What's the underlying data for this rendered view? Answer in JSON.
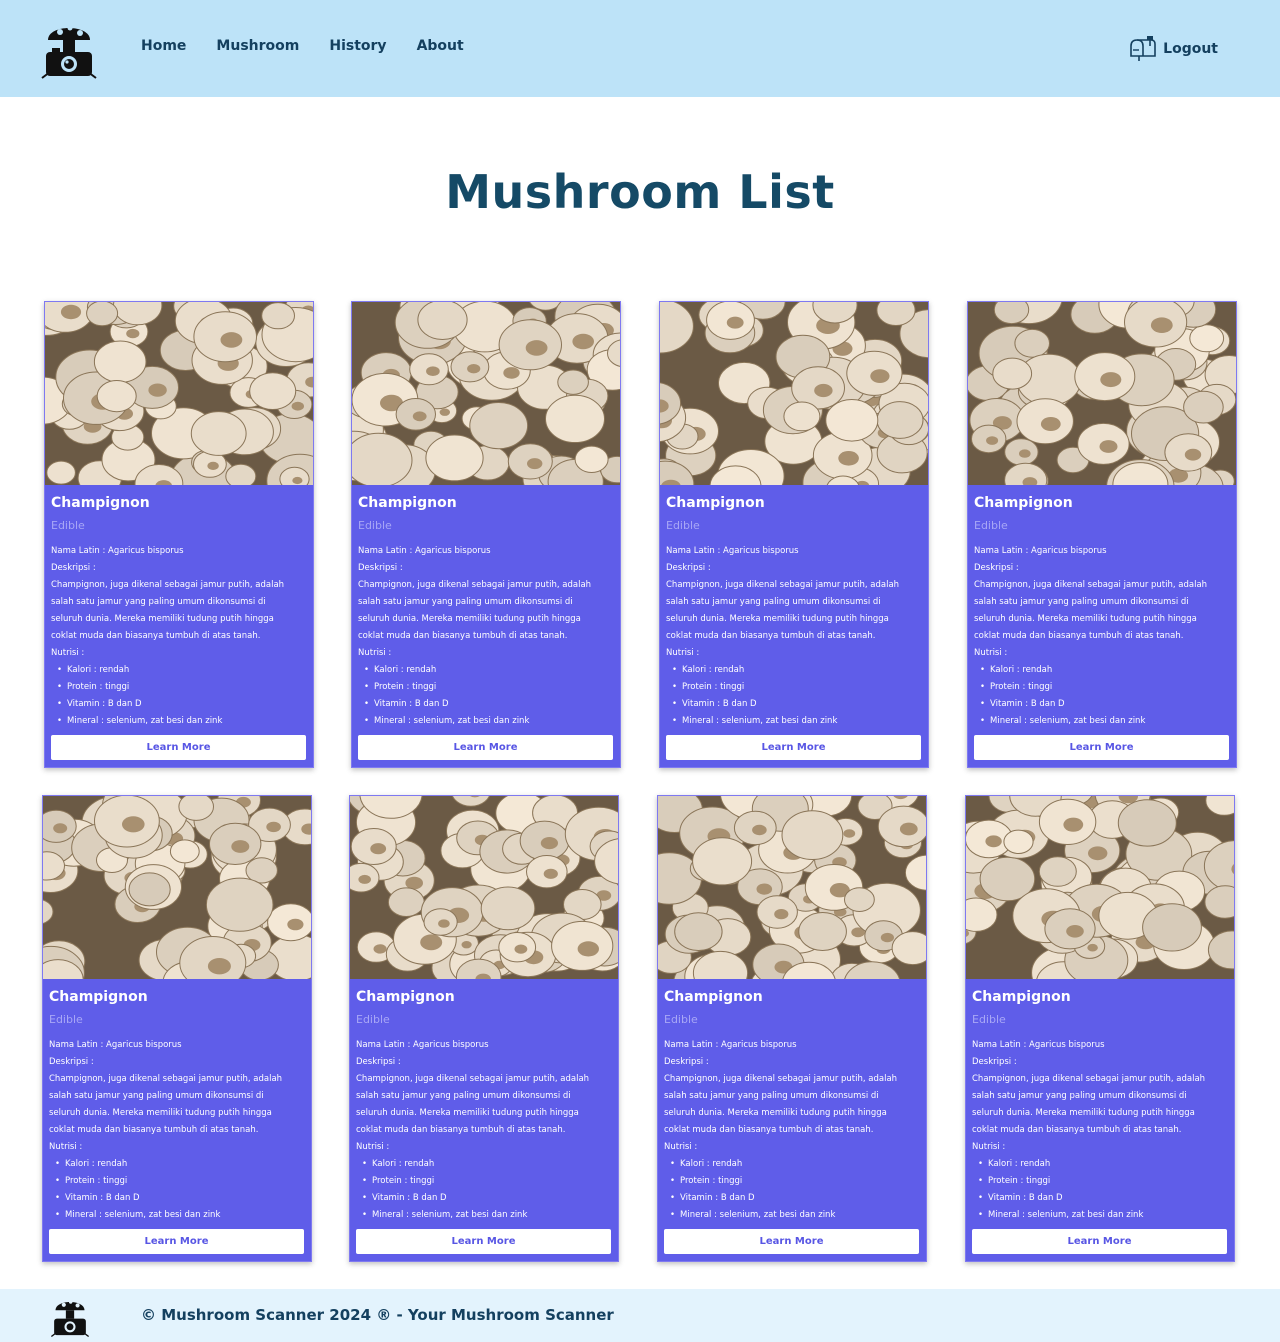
{
  "nav": {
    "logo_alt": "mushroom-camera-logo",
    "links": [
      "Home",
      "Mushroom",
      "History",
      "About"
    ],
    "logout_label": "Logout"
  },
  "page": {
    "title": "Mushroom List"
  },
  "cards": [
    {
      "name": "Champignon",
      "status": "Edible",
      "latin_label": "Nama Latin : Agaricus bisporus",
      "desc_label": "Deskripsi :",
      "desc_lines": [
        "Champignon, juga dikenal sebagai jamur putih, adalah",
        "salah satu jamur yang paling umum dikonsumsi di",
        "seluruh dunia. Mereka memiliki tudung putih hingga",
        "coklat muda dan biasanya tumbuh di atas tanah."
      ],
      "nutri_label": "Nutrisi :",
      "nutrients": [
        "Kalori : rendah",
        "Protein : tinggi",
        "Vitamin : B dan D",
        "Mineral : selenium, zat besi dan zink"
      ],
      "button": "Learn More"
    }
  ],
  "footer": {
    "text": "© Mushroom Scanner 2024 ® - Your Mushroom Scanner"
  },
  "colors": {
    "nav_bg": "#bde3f8",
    "card_bg": "#5f5de9",
    "title": "#154a66",
    "footer_bg": "#e3f3fd"
  },
  "icons": [
    "mushroom-camera-logo-icon",
    "mailbox-logout-icon"
  ]
}
